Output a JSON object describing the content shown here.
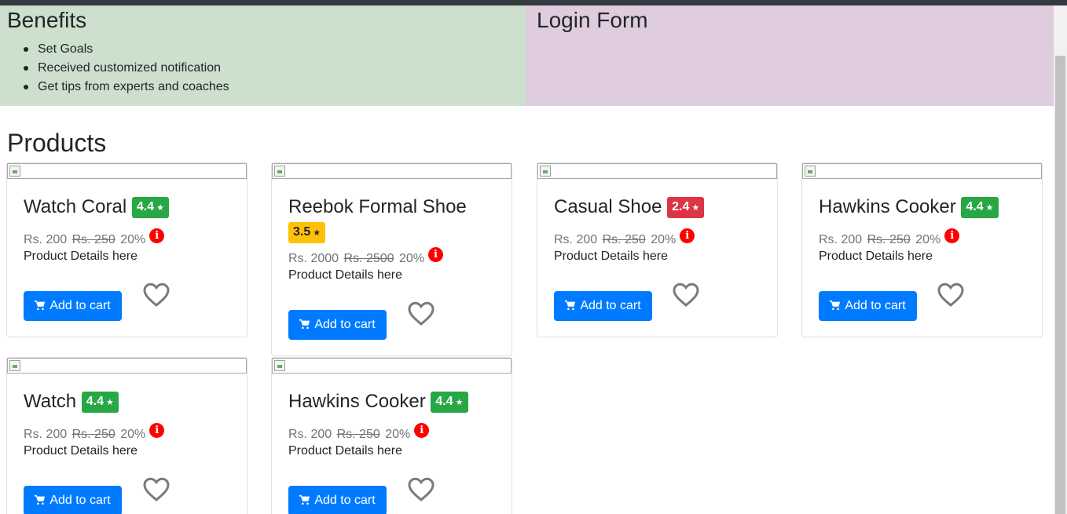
{
  "benefits": {
    "title": "Benefits",
    "items": [
      "Set Goals",
      "Received customized notification",
      "Get tips from experts and coaches"
    ]
  },
  "login": {
    "title": "Login Form"
  },
  "products": {
    "title": "Products",
    "cart_label": "Add to cart",
    "details_label": "Product Details here",
    "info_glyph": "i",
    "star_glyph": "★",
    "items": [
      {
        "name": "Watch Coral",
        "rating": "4.4",
        "rating_color": "#28a745",
        "price": "Rs. 200",
        "old_price": "Rs. 250",
        "discount": "20%"
      },
      {
        "name": "Reebok Formal Shoe",
        "rating": "3.5",
        "rating_color": "#ffc107",
        "price": "Rs. 2000",
        "old_price": "Rs. 2500",
        "discount": "20%"
      },
      {
        "name": "Casual Shoe",
        "rating": "2.4",
        "rating_color": "#dc3545",
        "price": "Rs. 200",
        "old_price": "Rs. 250",
        "discount": "20%"
      },
      {
        "name": "Hawkins Cooker",
        "rating": "4.4",
        "rating_color": "#28a745",
        "price": "Rs. 200",
        "old_price": "Rs. 250",
        "discount": "20%"
      },
      {
        "name": "Watch",
        "rating": "4.4",
        "rating_color": "#28a745",
        "price": "Rs. 200",
        "old_price": "Rs. 250",
        "discount": "20%"
      },
      {
        "name": "Hawkins Cooker",
        "rating": "4.4",
        "rating_color": "#28a745",
        "price": "Rs. 200",
        "old_price": "Rs. 250",
        "discount": "20%"
      }
    ]
  },
  "icons": {
    "product_image": "broken-image-icon",
    "cart": "cart-icon",
    "wishlist": "heart-outline-icon",
    "info": "info-icon"
  },
  "colors": {
    "primary": "#007bff",
    "benefits_bg": "#cddfcd",
    "login_bg": "#dfcddf",
    "info": "#ff0000",
    "navbar": "#343a40"
  }
}
